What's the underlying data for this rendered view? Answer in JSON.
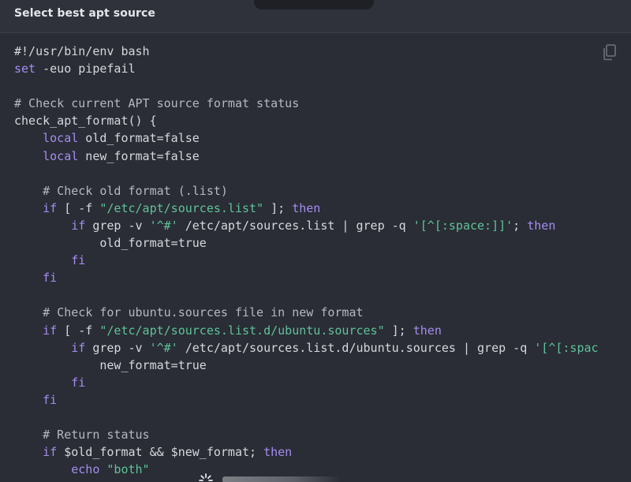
{
  "header": {
    "title": "Select best apt source"
  },
  "icons": {
    "copy": "copy-icon",
    "loading": "spinner-icon"
  },
  "colors": {
    "background": "#2a2d35",
    "header_bg": "#2f323b",
    "keyword": "#a48cf2",
    "string": "#5fc29a",
    "comment": "#b4b8c0",
    "text": "#d6d8dd"
  },
  "code": {
    "language": "bash",
    "lines": [
      [
        {
          "t": "#!/usr/bin/env bash",
          "c": "plain"
        }
      ],
      [
        {
          "t": "set",
          "c": "kw"
        },
        {
          "t": " -euo pipefail",
          "c": "plain"
        }
      ],
      [],
      [
        {
          "t": "# Check current APT source format status",
          "c": "cm"
        }
      ],
      [
        {
          "t": "check_apt_format() {",
          "c": "plain"
        }
      ],
      [
        {
          "t": "    ",
          "c": "plain"
        },
        {
          "t": "local",
          "c": "kw"
        },
        {
          "t": " old_format=false",
          "c": "plain"
        }
      ],
      [
        {
          "t": "    ",
          "c": "plain"
        },
        {
          "t": "local",
          "c": "kw"
        },
        {
          "t": " new_format=false",
          "c": "plain"
        }
      ],
      [],
      [
        {
          "t": "    # Check old format (.list)",
          "c": "cm"
        }
      ],
      [
        {
          "t": "    ",
          "c": "plain"
        },
        {
          "t": "if",
          "c": "kw"
        },
        {
          "t": " [ -f ",
          "c": "plain"
        },
        {
          "t": "\"/etc/apt/sources.list\"",
          "c": "str"
        },
        {
          "t": " ]; ",
          "c": "plain"
        },
        {
          "t": "then",
          "c": "kw"
        }
      ],
      [
        {
          "t": "        ",
          "c": "plain"
        },
        {
          "t": "if",
          "c": "kw"
        },
        {
          "t": " grep -v ",
          "c": "plain"
        },
        {
          "t": "'^#'",
          "c": "str"
        },
        {
          "t": " /etc/apt/sources.list | grep -q ",
          "c": "plain"
        },
        {
          "t": "'[^[:space:]]'",
          "c": "str"
        },
        {
          "t": "; ",
          "c": "plain"
        },
        {
          "t": "then",
          "c": "kw"
        }
      ],
      [
        {
          "t": "            old_format=true",
          "c": "plain"
        }
      ],
      [
        {
          "t": "        ",
          "c": "plain"
        },
        {
          "t": "fi",
          "c": "kw"
        }
      ],
      [
        {
          "t": "    ",
          "c": "plain"
        },
        {
          "t": "fi",
          "c": "kw"
        }
      ],
      [],
      [
        {
          "t": "    # Check for ubuntu.sources file in new format",
          "c": "cm"
        }
      ],
      [
        {
          "t": "    ",
          "c": "plain"
        },
        {
          "t": "if",
          "c": "kw"
        },
        {
          "t": " [ -f ",
          "c": "plain"
        },
        {
          "t": "\"/etc/apt/sources.list.d/ubuntu.sources\"",
          "c": "str"
        },
        {
          "t": " ]; ",
          "c": "plain"
        },
        {
          "t": "then",
          "c": "kw"
        }
      ],
      [
        {
          "t": "        ",
          "c": "plain"
        },
        {
          "t": "if",
          "c": "kw"
        },
        {
          "t": " grep -v ",
          "c": "plain"
        },
        {
          "t": "'^#'",
          "c": "str"
        },
        {
          "t": " /etc/apt/sources.list.d/ubuntu.sources | grep -q ",
          "c": "plain"
        },
        {
          "t": "'[^[:spac",
          "c": "str"
        }
      ],
      [
        {
          "t": "            new_format=true",
          "c": "plain"
        }
      ],
      [
        {
          "t": "        ",
          "c": "plain"
        },
        {
          "t": "fi",
          "c": "kw"
        }
      ],
      [
        {
          "t": "    ",
          "c": "plain"
        },
        {
          "t": "fi",
          "c": "kw"
        }
      ],
      [],
      [
        {
          "t": "    # Return status",
          "c": "cm"
        }
      ],
      [
        {
          "t": "    ",
          "c": "plain"
        },
        {
          "t": "if",
          "c": "kw"
        },
        {
          "t": " $old_format && $new_format; ",
          "c": "plain"
        },
        {
          "t": "then",
          "c": "kw"
        }
      ],
      [
        {
          "t": "        ",
          "c": "plain"
        },
        {
          "t": "echo",
          "c": "kw"
        },
        {
          "t": " ",
          "c": "plain"
        },
        {
          "t": "\"both\"",
          "c": "str"
        }
      ]
    ]
  }
}
